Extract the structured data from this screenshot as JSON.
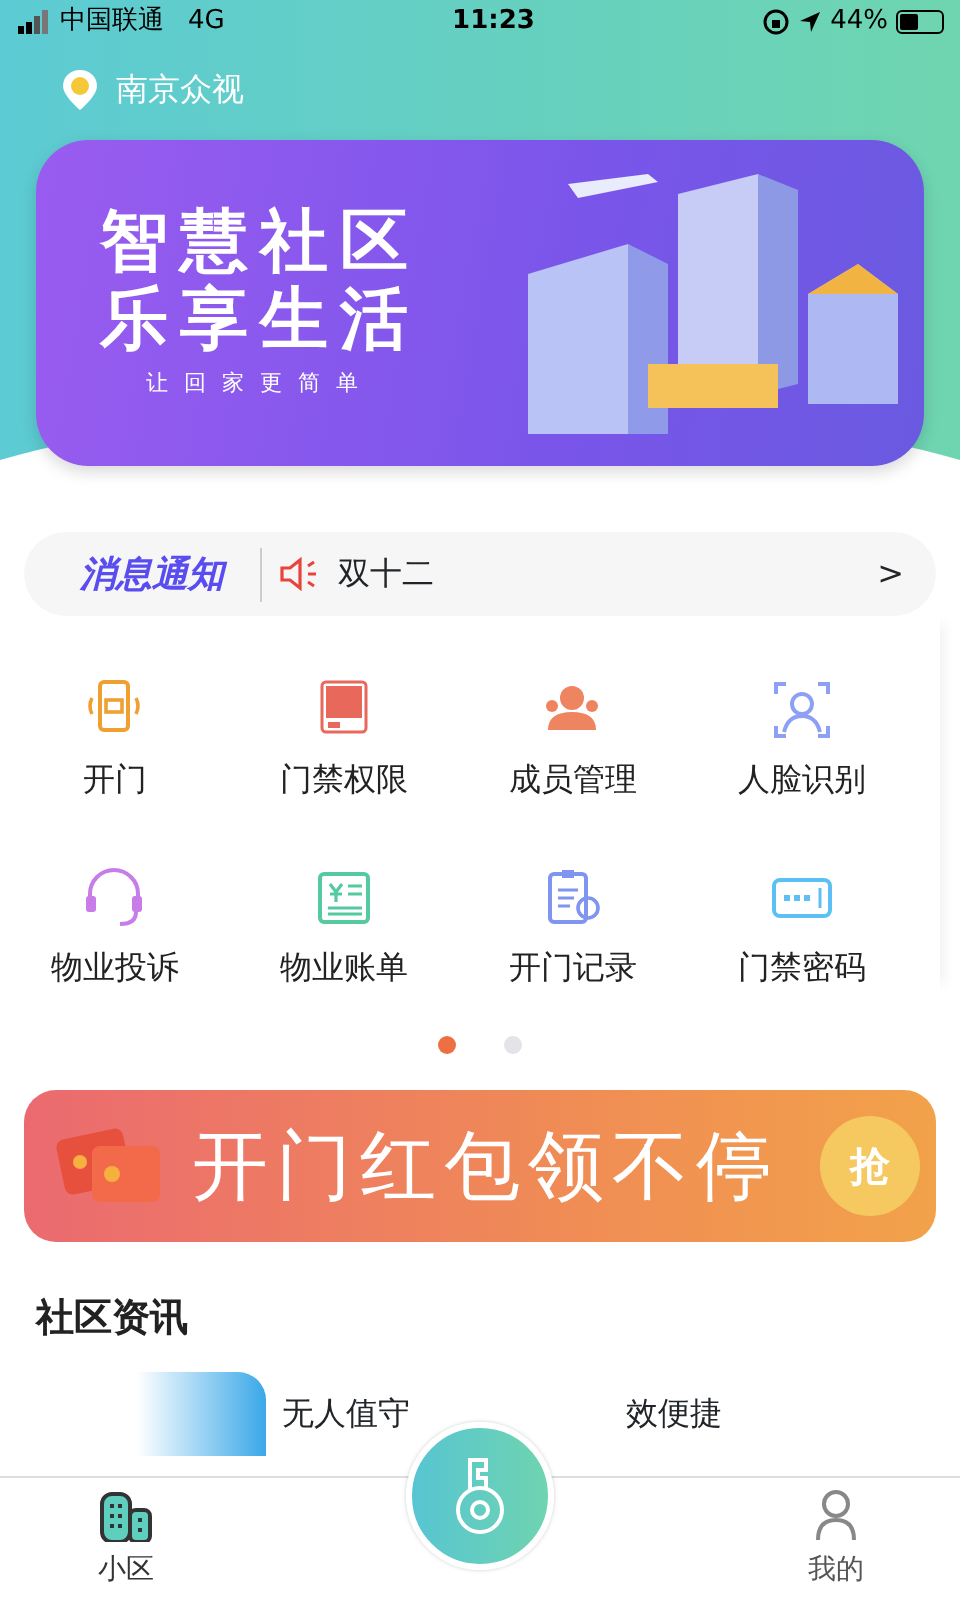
{
  "status_bar": {
    "carrier": "中国联通",
    "network": "4G",
    "time": "11:23",
    "battery_text": "44%",
    "battery": {
      "level": 0.44
    }
  },
  "location": {
    "name": "南京众视"
  },
  "banner": {
    "title_1": "智慧社区",
    "title_2": "乐享生活",
    "subtitle": "让回家更简单"
  },
  "notice": {
    "label": "消息通知",
    "text": "双十二",
    "arrow": ">"
  },
  "services": [
    {
      "label": "开门"
    },
    {
      "label": "门禁权限"
    },
    {
      "label": "成员管理"
    },
    {
      "label": "人脸识别"
    },
    {
      "label": "物业投诉"
    },
    {
      "label": "物业账单"
    },
    {
      "label": "开门记录"
    },
    {
      "label": "门禁密码"
    }
  ],
  "pager": [
    {
      "selected": true
    },
    {
      "selected": false
    }
  ],
  "promo": {
    "text": "开门红包领不停",
    "badge": "抢"
  },
  "news_section": {
    "title": "社区资讯",
    "items": [
      {
        "title_start": "无人值守",
        "title_end": "效便捷"
      }
    ]
  },
  "tabbar": [
    {
      "label": "小区",
      "kind": "community",
      "selected": true
    },
    {
      "kind": "key"
    },
    {
      "label": "我的",
      "kind": "profile",
      "selected": false
    }
  ]
}
